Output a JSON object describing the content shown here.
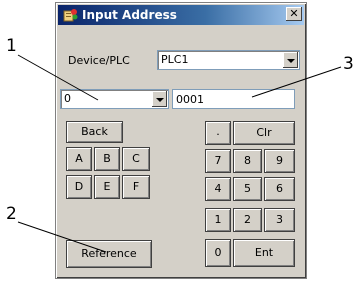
{
  "dialog": {
    "title": "Input Address",
    "close_glyph": "✕",
    "device_plc_label": "Device/PLC",
    "device_plc_value": "PLC1",
    "address_type_value": "0",
    "address_value": "0001",
    "keys": {
      "back": "Back",
      "dot": ".",
      "clr": "Clr",
      "a": "A",
      "b": "B",
      "c": "C",
      "d": "D",
      "e": "E",
      "f": "F",
      "k7": "7",
      "k8": "8",
      "k9": "9",
      "k4": "4",
      "k5": "5",
      "k6": "6",
      "k1": "1",
      "k2": "2",
      "k3": "3",
      "k0": "0",
      "ent": "Ent",
      "reference": "Reference"
    }
  },
  "callouts": {
    "c1": "1",
    "c2": "2",
    "c3": "3"
  },
  "icons": {
    "title": "address-book-icon",
    "close": "close-icon",
    "dropdown": "chevron-down-icon"
  }
}
